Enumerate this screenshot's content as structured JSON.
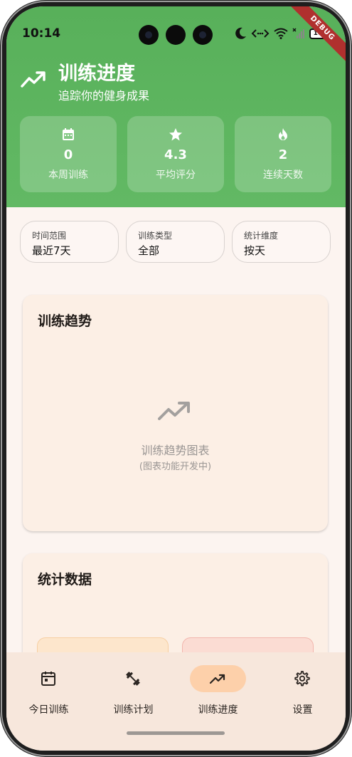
{
  "status_bar": {
    "time": "10:14",
    "battery": "100",
    "debug_banner": "DEBUG"
  },
  "header": {
    "title": "训练进度",
    "subtitle": "追踪你的健身成果"
  },
  "stats": [
    {
      "icon": "calendar-icon",
      "value": "0",
      "label": "本周训练"
    },
    {
      "icon": "star-icon",
      "value": "4.3",
      "label": "平均评分"
    },
    {
      "icon": "fire-icon",
      "value": "2",
      "label": "连续天数"
    }
  ],
  "filters": [
    {
      "label": "时间范围",
      "value": "最近7天"
    },
    {
      "label": "训练类型",
      "value": "全部"
    },
    {
      "label": "统计维度",
      "value": "按天"
    }
  ],
  "trend_card": {
    "title": "训练趋势",
    "placeholder": "训练趋势图表",
    "placeholder_note": "(图表功能开发中)"
  },
  "stats_card": {
    "title": "统计数据"
  },
  "bottom_nav": [
    {
      "label": "今日训练",
      "icon": "calendar-icon",
      "active": false
    },
    {
      "label": "训练计划",
      "icon": "dumbbell-icon",
      "active": false
    },
    {
      "label": "训练进度",
      "icon": "trending-up-icon",
      "active": true
    },
    {
      "label": "设置",
      "icon": "gear-icon",
      "active": false
    }
  ],
  "colors": {
    "header_green": "#5cb45e",
    "background": "#fcf4f0",
    "card": "#fcefe5",
    "nav_active": "#fdd0aa"
  }
}
